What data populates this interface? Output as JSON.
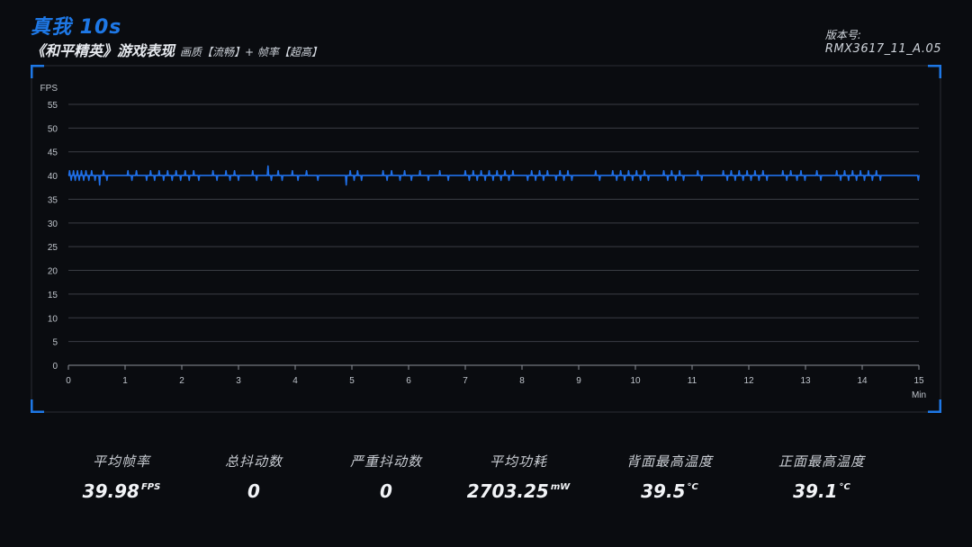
{
  "header": {
    "device": "真我 10s",
    "game": "《和平精英》游戏表现",
    "settings": "画质【流畅】+ 帧率【超高】",
    "version_label": "版本号:",
    "version_value": "RMX3617_11_A.05"
  },
  "colors": {
    "accent": "#1e78e6",
    "line": "#1f6fe8",
    "background": "#0a0c10",
    "grid": "#3a3d44"
  },
  "chart_data": {
    "type": "line",
    "xlabel": "Min",
    "ylabel": "FPS",
    "xlim": [
      0,
      15
    ],
    "ylim": [
      0,
      55
    ],
    "xticks": [
      0,
      1,
      2,
      3,
      4,
      5,
      6,
      7,
      8,
      9,
      10,
      11,
      12,
      13,
      14,
      15
    ],
    "yticks": [
      0,
      5,
      10,
      15,
      20,
      25,
      30,
      35,
      40,
      45,
      50,
      55
    ],
    "grid": "horizontal",
    "series": [
      {
        "baseline": 40,
        "spikes": [
          {
            "x": 0.02,
            "y": 41
          },
          {
            "x": 0.05,
            "y": 39
          },
          {
            "x": 0.09,
            "y": 41
          },
          {
            "x": 0.12,
            "y": 39
          },
          {
            "x": 0.16,
            "y": 41
          },
          {
            "x": 0.19,
            "y": 39
          },
          {
            "x": 0.23,
            "y": 41
          },
          {
            "x": 0.27,
            "y": 39
          },
          {
            "x": 0.31,
            "y": 41
          },
          {
            "x": 0.36,
            "y": 39
          },
          {
            "x": 0.41,
            "y": 41
          },
          {
            "x": 0.47,
            "y": 39
          },
          {
            "x": 0.55,
            "y": 38
          },
          {
            "x": 0.62,
            "y": 41
          },
          {
            "x": 0.68,
            "y": 39
          },
          {
            "x": 1.05,
            "y": 41
          },
          {
            "x": 1.12,
            "y": 39
          },
          {
            "x": 1.2,
            "y": 41
          },
          {
            "x": 1.38,
            "y": 39
          },
          {
            "x": 1.45,
            "y": 41
          },
          {
            "x": 1.52,
            "y": 39
          },
          {
            "x": 1.6,
            "y": 41
          },
          {
            "x": 1.68,
            "y": 39
          },
          {
            "x": 1.75,
            "y": 41
          },
          {
            "x": 1.83,
            "y": 39
          },
          {
            "x": 1.9,
            "y": 41
          },
          {
            "x": 1.98,
            "y": 39
          },
          {
            "x": 2.06,
            "y": 41
          },
          {
            "x": 2.13,
            "y": 39
          },
          {
            "x": 2.21,
            "y": 41
          },
          {
            "x": 2.3,
            "y": 39
          },
          {
            "x": 2.55,
            "y": 41
          },
          {
            "x": 2.62,
            "y": 39
          },
          {
            "x": 2.78,
            "y": 41
          },
          {
            "x": 2.85,
            "y": 39
          },
          {
            "x": 2.93,
            "y": 41
          },
          {
            "x": 3.0,
            "y": 39
          },
          {
            "x": 3.25,
            "y": 41
          },
          {
            "x": 3.32,
            "y": 39
          },
          {
            "x": 3.52,
            "y": 42
          },
          {
            "x": 3.58,
            "y": 39
          },
          {
            "x": 3.7,
            "y": 41
          },
          {
            "x": 3.77,
            "y": 39
          },
          {
            "x": 3.95,
            "y": 41
          },
          {
            "x": 4.05,
            "y": 39
          },
          {
            "x": 4.2,
            "y": 41
          },
          {
            "x": 4.4,
            "y": 39
          },
          {
            "x": 4.9,
            "y": 38
          },
          {
            "x": 4.97,
            "y": 41
          },
          {
            "x": 5.04,
            "y": 39
          },
          {
            "x": 5.1,
            "y": 41
          },
          {
            "x": 5.17,
            "y": 39
          },
          {
            "x": 5.55,
            "y": 41
          },
          {
            "x": 5.62,
            "y": 39
          },
          {
            "x": 5.7,
            "y": 41
          },
          {
            "x": 5.85,
            "y": 39
          },
          {
            "x": 5.93,
            "y": 41
          },
          {
            "x": 6.05,
            "y": 39
          },
          {
            "x": 6.2,
            "y": 41
          },
          {
            "x": 6.35,
            "y": 39
          },
          {
            "x": 6.55,
            "y": 41
          },
          {
            "x": 6.7,
            "y": 39
          },
          {
            "x": 7.0,
            "y": 41
          },
          {
            "x": 7.07,
            "y": 39
          },
          {
            "x": 7.14,
            "y": 41
          },
          {
            "x": 7.21,
            "y": 39
          },
          {
            "x": 7.28,
            "y": 41
          },
          {
            "x": 7.35,
            "y": 39
          },
          {
            "x": 7.42,
            "y": 41
          },
          {
            "x": 7.49,
            "y": 39
          },
          {
            "x": 7.56,
            "y": 41
          },
          {
            "x": 7.63,
            "y": 39
          },
          {
            "x": 7.7,
            "y": 41
          },
          {
            "x": 7.77,
            "y": 39
          },
          {
            "x": 7.84,
            "y": 41
          },
          {
            "x": 8.1,
            "y": 39
          },
          {
            "x": 8.17,
            "y": 41
          },
          {
            "x": 8.24,
            "y": 39
          },
          {
            "x": 8.31,
            "y": 41
          },
          {
            "x": 8.38,
            "y": 39
          },
          {
            "x": 8.45,
            "y": 41
          },
          {
            "x": 8.6,
            "y": 39
          },
          {
            "x": 8.67,
            "y": 41
          },
          {
            "x": 8.74,
            "y": 39
          },
          {
            "x": 8.81,
            "y": 41
          },
          {
            "x": 8.88,
            "y": 39
          },
          {
            "x": 9.3,
            "y": 41
          },
          {
            "x": 9.37,
            "y": 39
          },
          {
            "x": 9.6,
            "y": 41
          },
          {
            "x": 9.67,
            "y": 39
          },
          {
            "x": 9.74,
            "y": 41
          },
          {
            "x": 9.81,
            "y": 39
          },
          {
            "x": 9.88,
            "y": 41
          },
          {
            "x": 9.95,
            "y": 39
          },
          {
            "x": 10.02,
            "y": 41
          },
          {
            "x": 10.09,
            "y": 39
          },
          {
            "x": 10.16,
            "y": 41
          },
          {
            "x": 10.23,
            "y": 39
          },
          {
            "x": 10.5,
            "y": 41
          },
          {
            "x": 10.57,
            "y": 39
          },
          {
            "x": 10.64,
            "y": 41
          },
          {
            "x": 10.71,
            "y": 39
          },
          {
            "x": 10.78,
            "y": 41
          },
          {
            "x": 10.85,
            "y": 39
          },
          {
            "x": 11.1,
            "y": 41
          },
          {
            "x": 11.17,
            "y": 39
          },
          {
            "x": 11.55,
            "y": 41
          },
          {
            "x": 11.62,
            "y": 39
          },
          {
            "x": 11.69,
            "y": 41
          },
          {
            "x": 11.76,
            "y": 39
          },
          {
            "x": 11.83,
            "y": 41
          },
          {
            "x": 11.9,
            "y": 39
          },
          {
            "x": 11.97,
            "y": 41
          },
          {
            "x": 12.04,
            "y": 39
          },
          {
            "x": 12.11,
            "y": 41
          },
          {
            "x": 12.18,
            "y": 39
          },
          {
            "x": 12.25,
            "y": 41
          },
          {
            "x": 12.32,
            "y": 39
          },
          {
            "x": 12.6,
            "y": 41
          },
          {
            "x": 12.67,
            "y": 39
          },
          {
            "x": 12.74,
            "y": 41
          },
          {
            "x": 12.85,
            "y": 39
          },
          {
            "x": 12.92,
            "y": 41
          },
          {
            "x": 12.99,
            "y": 39
          },
          {
            "x": 13.2,
            "y": 41
          },
          {
            "x": 13.27,
            "y": 39
          },
          {
            "x": 13.55,
            "y": 41
          },
          {
            "x": 13.62,
            "y": 39
          },
          {
            "x": 13.69,
            "y": 41
          },
          {
            "x": 13.76,
            "y": 39
          },
          {
            "x": 13.83,
            "y": 41
          },
          {
            "x": 13.9,
            "y": 39
          },
          {
            "x": 13.97,
            "y": 41
          },
          {
            "x": 14.04,
            "y": 39
          },
          {
            "x": 14.11,
            "y": 41
          },
          {
            "x": 14.18,
            "y": 39
          },
          {
            "x": 14.25,
            "y": 41
          },
          {
            "x": 14.32,
            "y": 39
          },
          {
            "x": 14.99,
            "y": 39
          }
        ]
      }
    ]
  },
  "stats": [
    {
      "label": "平均帧率",
      "value": "39.98",
      "unit": "FPS"
    },
    {
      "label": "总抖动数",
      "value": "0",
      "unit": ""
    },
    {
      "label": "严重抖动数",
      "value": "0",
      "unit": ""
    },
    {
      "label": "平均功耗",
      "value": "2703.25",
      "unit": "mW"
    },
    {
      "label": "背面最高温度",
      "value": "39.5",
      "unit": "°C"
    },
    {
      "label": "正面最高温度",
      "value": "39.1",
      "unit": "°C"
    }
  ]
}
